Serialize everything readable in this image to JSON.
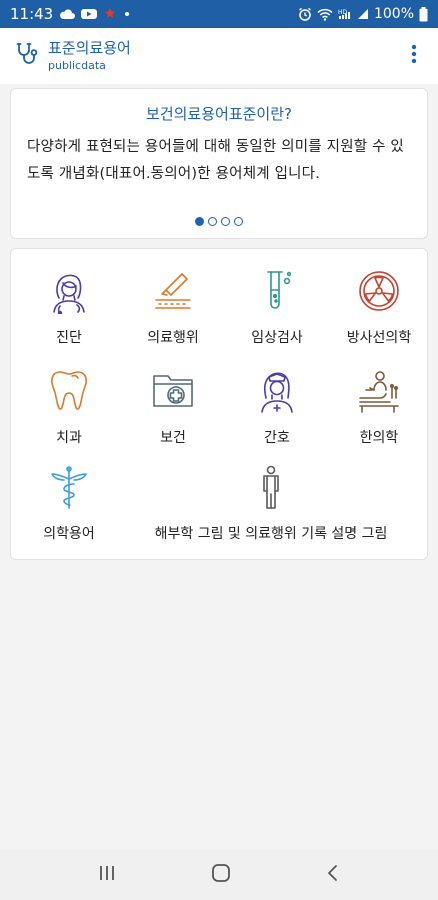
{
  "status_bar": {
    "time": "11:43",
    "battery": "100%",
    "left_icons": [
      "cloud-icon",
      "youtube-icon",
      "app-icon",
      "dot-icon"
    ],
    "right_icons": [
      "alarm-icon",
      "wifi-icon",
      "hd-icon",
      "signal-icon",
      "battery-icon"
    ]
  },
  "app_bar": {
    "title": "표준의료용어",
    "subtitle": "publicdata",
    "icon": "stethoscope-icon",
    "menu_icon": "more-vert-icon"
  },
  "info_card": {
    "title": "보건의료용어표준이란?",
    "body": "다양하게 표현되는 용어들에 대해 동일한 의미를 지원할 수 있도록 개념화(대표어.동의어)한 용어체계 입니다.",
    "pager": {
      "count": 4,
      "active": 1
    }
  },
  "categories": [
    {
      "label": "진단",
      "icon": "doctor-icon"
    },
    {
      "label": "의료행위",
      "icon": "scalpel-icon"
    },
    {
      "label": "임상검사",
      "icon": "test-tube-icon"
    },
    {
      "label": "방사선의학",
      "icon": "radiation-icon"
    },
    {
      "label": "치과",
      "icon": "tooth-icon"
    },
    {
      "label": "보건",
      "icon": "medical-folder-icon"
    },
    {
      "label": "간호",
      "icon": "nurse-icon"
    },
    {
      "label": "한의학",
      "icon": "acupuncture-icon"
    },
    {
      "label": "의학용어",
      "icon": "caduceus-icon"
    },
    {
      "label": "해부학 그림 및 의료행위 기록 설명 그림",
      "icon": "human-body-icon"
    }
  ],
  "colors": {
    "status_bar": "#1f5fa6",
    "accent": "#1e62b0",
    "purple": "#4d3aa8",
    "orange": "#d97a2c",
    "teal": "#2a9a8c",
    "red": "#c8412e",
    "sky": "#3c9ee0",
    "slate": "#4f6a78",
    "gray": "#5a5a5a",
    "brown": "#7a5a3a"
  },
  "nav_bar": {
    "recent_icon": "recent-apps-icon",
    "home_icon": "home-icon",
    "back_icon": "back-icon"
  }
}
